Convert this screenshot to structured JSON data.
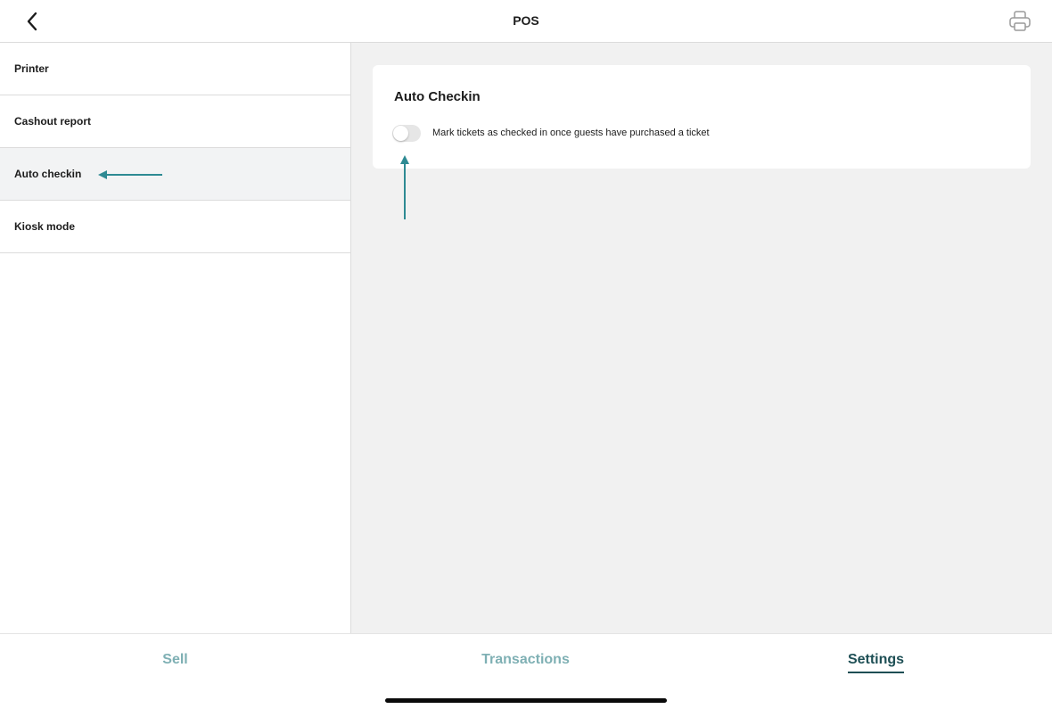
{
  "header": {
    "title": "POS",
    "back_icon": "chevron-left-icon",
    "printer_icon": "printer-icon"
  },
  "sidebar": {
    "items": [
      {
        "label": "Printer"
      },
      {
        "label": "Cashout report"
      },
      {
        "label": "Auto checkin",
        "active": true
      },
      {
        "label": "Kiosk mode"
      }
    ]
  },
  "main": {
    "card": {
      "title": "Auto Checkin",
      "toggle_on": false,
      "toggle_label": "Mark tickets as checked in once guests have purchased a ticket"
    }
  },
  "tabs": [
    {
      "label": "Sell"
    },
    {
      "label": "Transactions"
    },
    {
      "label": "Settings",
      "active": true
    }
  ],
  "colors": {
    "accent": "#1e4f55",
    "tab_inactive": "#7fb0b4",
    "annotation_arrow": "#2e8a93",
    "main_background": "#f1f1f1",
    "active_row_background": "#f2f3f4"
  }
}
